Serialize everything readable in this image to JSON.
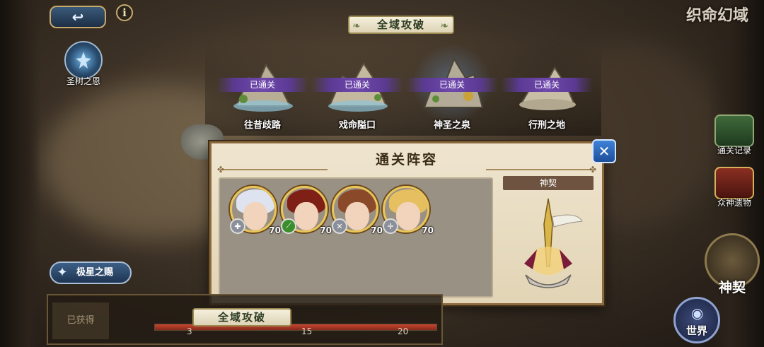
{
  "header": {
    "back_icon": "return-arrow-icon",
    "info_icon": "info-icon",
    "tree_gift_label": "圣树之恩",
    "page_title": "全域攻破",
    "game_title": "织命幻域"
  },
  "stages": [
    {
      "name": "往昔歧路",
      "status": "已通关"
    },
    {
      "name": "戏命隘口",
      "status": "已通关"
    },
    {
      "name": "神圣之泉",
      "status": "已通关"
    },
    {
      "name": "行刑之地",
      "status": "已通关"
    }
  ],
  "dialog": {
    "title": "通关阵容",
    "close_icon": "close-x-icon",
    "contract_label": "神契",
    "heroes": [
      {
        "level": "70",
        "class_icon": "dual-cross-icon",
        "hair_color": "#dfe3ef",
        "class_color": "#8a8f9a"
      },
      {
        "level": "70",
        "class_icon": "leaf-staff-icon",
        "hair_color": "#7e2016",
        "class_color": "#3a8e2c"
      },
      {
        "level": "70",
        "class_icon": "crossed-swords-icon",
        "hair_color": "#8a4a2a",
        "class_color": "#8a8f9a"
      },
      {
        "level": "70",
        "class_icon": "shield-cross-icon",
        "hair_color": "#e6c060",
        "class_color": "#8a8f9a"
      }
    ]
  },
  "bottom": {
    "star_gift_label": "极星之赐",
    "obtained_label": "已获得",
    "bottom_title": "全域攻破",
    "milestones": [
      "3",
      "15",
      "20"
    ],
    "progress": 1.0
  },
  "sidebar": {
    "clear_record_label": "通关记录",
    "relics_label": "众神遗物",
    "contract_label": "神契",
    "world_label": "世界"
  },
  "colors": {
    "accent_gold": "#c9ae72",
    "badge_purple": "#5b3a93",
    "close_blue": "#3f82d8"
  }
}
